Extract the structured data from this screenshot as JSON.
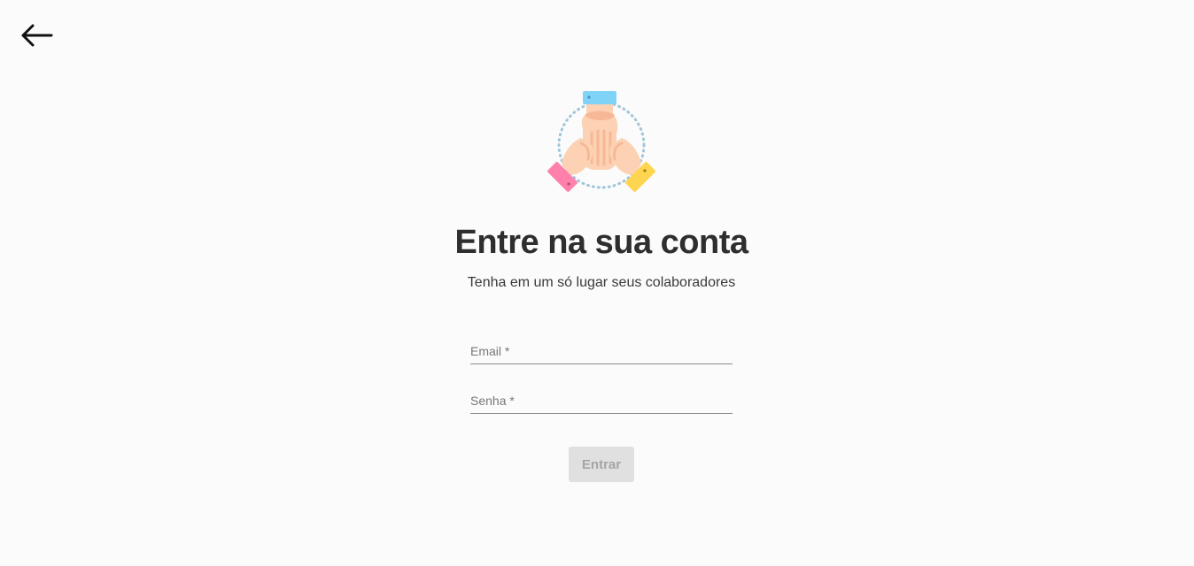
{
  "header": {
    "back_icon": "arrow-left-icon"
  },
  "logo": {
    "icon": "team-hands-icon",
    "colors": {
      "top_cuff": "#7fd3f7",
      "left_cuff": "#ff80ab",
      "right_cuff": "#ffd54f",
      "skin": "#fdd1b3",
      "skin_shade": "#f6b896",
      "ring": "#9fc6d9"
    }
  },
  "main": {
    "title": "Entre na sua conta",
    "subtitle": "Tenha em um só lugar seus colaboradores"
  },
  "form": {
    "email": {
      "label": "Email *",
      "value": ""
    },
    "password": {
      "label": "Senha *",
      "value": ""
    },
    "submit_label": "Entrar"
  },
  "colors": {
    "background": "#fbfbfb",
    "button_disabled_bg": "#e0e0e0",
    "button_disabled_text": "#a5a5a5"
  }
}
